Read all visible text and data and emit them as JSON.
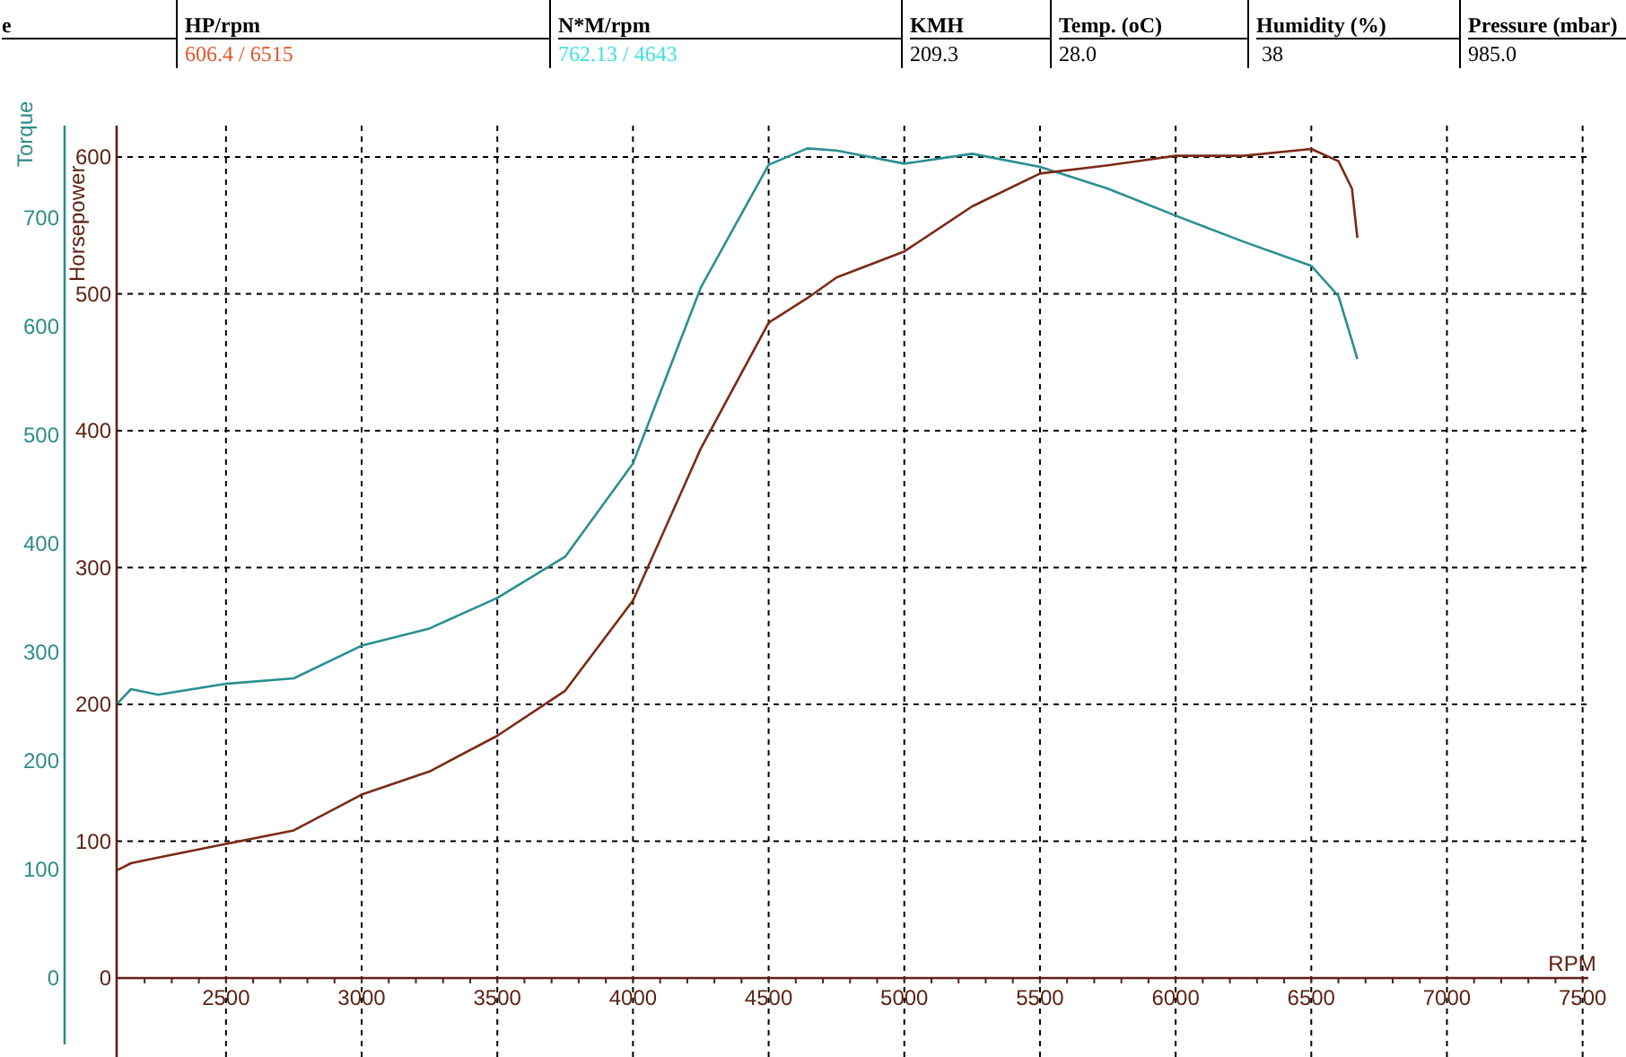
{
  "summary_table": {
    "columns": [
      {
        "header": "e"
      },
      {
        "header": "HP/rpm",
        "value": "606.4 / 6515",
        "color": "#e8542a"
      },
      {
        "header": "N*M/rpm",
        "value": "762.13 / 4643",
        "color": "#3ee0e0"
      },
      {
        "header": "KMH",
        "value": "209.3",
        "color": "#000000"
      },
      {
        "header": "Temp. (oC)",
        "value": "28.0",
        "color": "#000000"
      },
      {
        "header": "Humidity (%)",
        "value": " 38",
        "color": "#000000"
      },
      {
        "header": "Pressure (mbar)",
        "value": "985.0",
        "color": "#000000"
      }
    ]
  },
  "chart_data": {
    "type": "line",
    "xlabel": "RPM",
    "grid": true,
    "x": [
      2100,
      2150,
      2250,
      2500,
      2750,
      3000,
      3250,
      3500,
      3750,
      4000,
      4250,
      4500,
      4643,
      4750,
      5000,
      5250,
      5500,
      5750,
      6000,
      6250,
      6500,
      6600,
      6650,
      6670
    ],
    "series": [
      {
        "name": "Torque",
        "color": "#2a8f8f",
        "axis": "y2",
        "values": [
          253,
          266,
          261,
          271,
          276,
          306,
          322,
          350,
          388,
          474,
          636,
          749,
          764,
          762,
          750,
          759,
          747,
          727,
          702,
          678,
          656,
          628,
          587,
          570
        ]
      },
      {
        "name": "Horsepower",
        "color": "#7a2a16",
        "axis": "y",
        "values": [
          79,
          84,
          88,
          98,
          108,
          134,
          151,
          177,
          210,
          276,
          387,
          479,
          497,
          512,
          531,
          564,
          588,
          594,
          601,
          601,
          606,
          597,
          577,
          541
        ]
      }
    ],
    "xlim": [
      2097,
      7521
    ],
    "ylim": [
      0,
      623
    ],
    "y2lim": [
      0,
      785
    ],
    "xticks": [
      2500,
      3000,
      3500,
      4000,
      4500,
      5000,
      5500,
      6000,
      6500,
      7000,
      7500
    ],
    "yticks": [
      0,
      100,
      200,
      300,
      400,
      500,
      600
    ],
    "y2ticks": [
      0,
      100,
      200,
      300,
      400,
      500,
      600,
      700
    ]
  }
}
